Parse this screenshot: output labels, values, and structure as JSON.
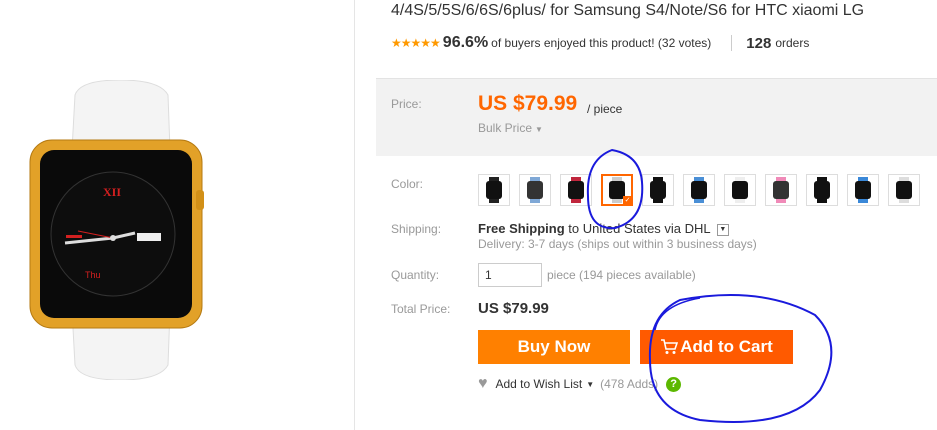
{
  "product": {
    "title": "4/4S/5/5S/6/6S/6plus/ for Samsung S4/Note/S6 for HTC xiaomi LG",
    "rating": {
      "stars": "★★★★★",
      "percent": "96.6%",
      "text": "of buyers enjoyed this product! (32 votes)",
      "orders_count": "128",
      "orders_label": "orders"
    }
  },
  "price": {
    "label": "Price:",
    "value": "US $79.99",
    "unit": "/ piece",
    "bulk_label": "Bulk Price",
    "bulk_caret": "▼"
  },
  "color": {
    "label": "Color:",
    "selected_index": 3,
    "swatches": [
      {
        "face": "#111111",
        "band": "#222222"
      },
      {
        "face": "#333333",
        "band": "#7fa8d6"
      },
      {
        "face": "#111111",
        "band": "#c0263d"
      },
      {
        "face": "#111111",
        "band": "#cccccc"
      },
      {
        "face": "#111111",
        "band": "#111111"
      },
      {
        "face": "#111111",
        "band": "#4a8fd6"
      },
      {
        "face": "#111111",
        "band": "#eeeeee"
      },
      {
        "face": "#333333",
        "band": "#f08ab8"
      },
      {
        "face": "#111111",
        "band": "#111111"
      },
      {
        "face": "#111111",
        "band": "#3a88d8"
      },
      {
        "face": "#111111",
        "band": "#dddddd"
      }
    ]
  },
  "shipping": {
    "label": "Shipping:",
    "free": "Free Shipping",
    "to_text": "to United States via DHL",
    "dropdown": "▼",
    "delivery": "Delivery: 3-7 days (ships out within 3 business days)"
  },
  "quantity": {
    "label": "Quantity:",
    "value": "1",
    "available": "piece (194 pieces available)"
  },
  "total": {
    "label": "Total Price:",
    "value": "US $79.99"
  },
  "actions": {
    "buy_now": "Buy Now",
    "add_to_cart": "Add to Cart",
    "wish_list": "Add to Wish List",
    "wish_caret": "▼",
    "adds": "(478 Adds)",
    "help": "?"
  },
  "colors": {
    "accent_orange": "#ff6600",
    "buy_button": "#ff8000",
    "cart_button": "#ff5a00",
    "star": "#ff9900",
    "annotation_ink": "#1a1adc"
  },
  "icons": {
    "heart": "♥",
    "cart": "cart-icon"
  }
}
